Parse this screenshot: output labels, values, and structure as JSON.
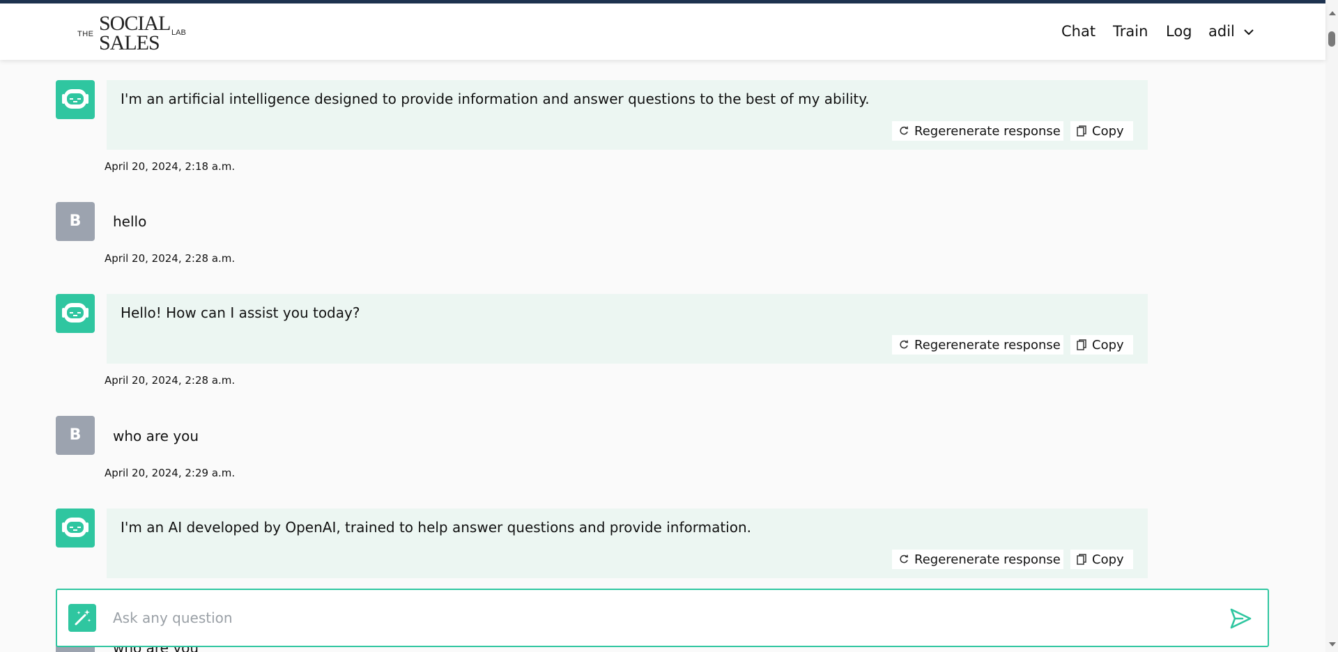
{
  "brand": {
    "logo_the": "THE",
    "logo_line1": "SOCIAL",
    "logo_line2": "SALES",
    "logo_lab": "LAB"
  },
  "nav": {
    "chat": "Chat",
    "train": "Train",
    "log": "Log",
    "user": "adil"
  },
  "actions": {
    "regenerate": "Regerenerate response",
    "copy": "Copy"
  },
  "messages": [
    {
      "role": "bot",
      "text": "I'm an artificial intelligence designed to provide information and answer questions to the best of my ability.",
      "timestamp": "April 20, 2024, 2:18 a.m."
    },
    {
      "role": "user",
      "avatar_letter": "B",
      "text": "hello",
      "timestamp": "April 20, 2024, 2:28 a.m."
    },
    {
      "role": "bot",
      "text": "Hello! How can I assist you today?",
      "timestamp": "April 20, 2024, 2:28 a.m."
    },
    {
      "role": "user",
      "avatar_letter": "B",
      "text": "who are you",
      "timestamp": "April 20, 2024, 2:29 a.m."
    },
    {
      "role": "bot",
      "text": "I'm an AI developed by OpenAI, trained to help answer questions and provide information."
    },
    {
      "role": "user",
      "text": "who are you"
    }
  ],
  "composer": {
    "placeholder": "Ask any question"
  },
  "icons": {
    "bot_avatar": "robot-icon",
    "regenerate": "refresh-icon",
    "copy": "copy-icon",
    "magic": "magic-wand-icon",
    "send": "send-icon",
    "user_menu": "chevron-down-icon"
  },
  "colors": {
    "accent": "#2fc6a0",
    "bot_bubble": "#ecf6f2",
    "user_avatar": "#9ca3af",
    "top_stripe": "#1e3350"
  }
}
